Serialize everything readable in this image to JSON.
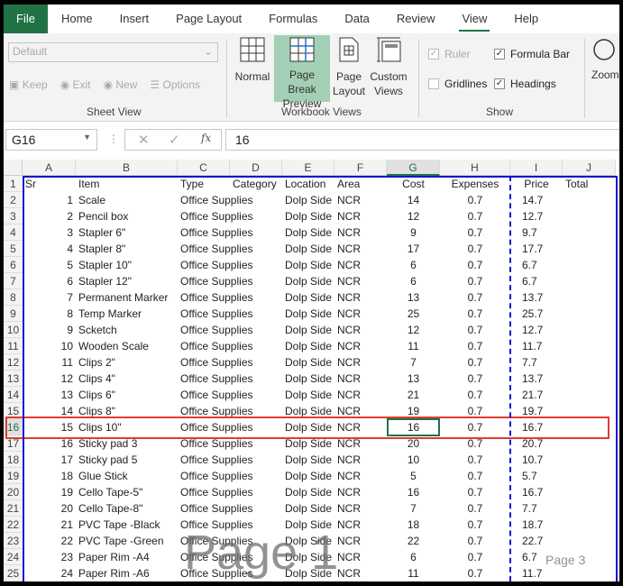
{
  "tabs": [
    "File",
    "Home",
    "Insert",
    "Page Layout",
    "Formulas",
    "Data",
    "Review",
    "View",
    "Help"
  ],
  "active_tab": "View",
  "ribbon": {
    "sheet_view": {
      "dropdown": "Default",
      "keep": "Keep",
      "exit": "Exit",
      "new": "New",
      "options": "Options",
      "label": "Sheet View"
    },
    "workbook_views": {
      "normal": "Normal",
      "page_break_1": "Page Break",
      "page_break_2": "Preview",
      "page_layout_1": "Page",
      "page_layout_2": "Layout",
      "custom_1": "Custom",
      "custom_2": "Views",
      "label": "Workbook Views"
    },
    "show": {
      "ruler": "Ruler",
      "formula_bar": "Formula Bar",
      "gridlines": "Gridlines",
      "headings": "Headings",
      "label": "Show",
      "ruler_checked": true,
      "formula_bar_checked": true,
      "gridlines_checked": false,
      "headings_checked": true
    },
    "zoom": "Zoom"
  },
  "formula_bar": {
    "name_box": "G16",
    "fx": "fx",
    "value": "16"
  },
  "columns": [
    "A",
    "B",
    "C",
    "D",
    "E",
    "F",
    "G",
    "H",
    "I",
    "J"
  ],
  "headers": [
    "Sr",
    "Item",
    "Type",
    "Category",
    "Location",
    "Area",
    "Cost",
    "Expenses",
    "Price",
    "Total"
  ],
  "rows": [
    [
      "1",
      "Scale",
      "Office Supplies",
      "Dolp Side",
      "NCR",
      "14",
      "0.7",
      "14.7"
    ],
    [
      "2",
      "Pencil box",
      "Office Supplies",
      "Dolp Side",
      "NCR",
      "12",
      "0.7",
      "12.7"
    ],
    [
      "3",
      "Stapler 6\"",
      "Office Supplies",
      "Dolp Side",
      "NCR",
      "9",
      "0.7",
      "9.7"
    ],
    [
      "4",
      "Stapler 8\"",
      "Office Supplies",
      "Dolp Side",
      "NCR",
      "17",
      "0.7",
      "17.7"
    ],
    [
      "5",
      "Stapler 10\"",
      "Office Supplies",
      "Dolp Side",
      "NCR",
      "6",
      "0.7",
      "6.7"
    ],
    [
      "6",
      "Stapler 12\"",
      "Office Supplies",
      "Dolp Side",
      "NCR",
      "6",
      "0.7",
      "6.7"
    ],
    [
      "7",
      "Permanent Marker",
      "Office Supplies",
      "Dolp Side",
      "NCR",
      "13",
      "0.7",
      "13.7"
    ],
    [
      "8",
      "Temp Marker",
      "Office Supplies",
      "Dolp Side",
      "NCR",
      "25",
      "0.7",
      "25.7"
    ],
    [
      "9",
      "Scketch",
      "Office Supplies",
      "Dolp Side",
      "NCR",
      "12",
      "0.7",
      "12.7"
    ],
    [
      "10",
      "Wooden Scale",
      "Office Supplies",
      "Dolp Side",
      "NCR",
      "11",
      "0.7",
      "11.7"
    ],
    [
      "11",
      "Clips 2\"",
      "Office Supplies",
      "Dolp Side",
      "NCR",
      "7",
      "0.7",
      "7.7"
    ],
    [
      "12",
      "Clips 4\"",
      "Office Supplies",
      "Dolp Side",
      "NCR",
      "13",
      "0.7",
      "13.7"
    ],
    [
      "13",
      "Clips 6\"",
      "Office Supplies",
      "Dolp Side",
      "NCR",
      "21",
      "0.7",
      "21.7"
    ],
    [
      "14",
      "Clips 8\"",
      "Office Supplies",
      "Dolp Side",
      "NCR",
      "19",
      "0.7",
      "19.7"
    ],
    [
      "15",
      "Clips 10\"",
      "Office Supplies",
      "Dolp Side",
      "NCR",
      "16",
      "0.7",
      "16.7"
    ],
    [
      "16",
      "Sticky pad  3",
      "Office Supplies",
      "Dolp Side",
      "NCR",
      "20",
      "0.7",
      "20.7"
    ],
    [
      "17",
      "Sticky pad  5",
      "Office Supplies",
      "Dolp Side",
      "NCR",
      "10",
      "0.7",
      "10.7"
    ],
    [
      "18",
      "Glue Stick",
      "Office Supplies",
      "Dolp Side",
      "NCR",
      "5",
      "0.7",
      "5.7"
    ],
    [
      "19",
      "Cello Tape-5\"",
      "Office Supplies",
      "Dolp Side",
      "NCR",
      "16",
      "0.7",
      "16.7"
    ],
    [
      "20",
      "Cello Tape-8\"",
      "Office Supplies",
      "Dolp Side",
      "NCR",
      "7",
      "0.7",
      "7.7"
    ],
    [
      "21",
      "PVC Tape -Black",
      "Office Supplies",
      "Dolp Side",
      "NCR",
      "18",
      "0.7",
      "18.7"
    ],
    [
      "22",
      "PVC Tape -Green",
      "Office Supplies",
      "Dolp Side",
      "NCR",
      "22",
      "0.7",
      "22.7"
    ],
    [
      "23",
      "Paper Rim -A4",
      "Office Supplies",
      "Dolp Side",
      "NCR",
      "6",
      "0.7",
      "6.7"
    ],
    [
      "24",
      "Paper Rim -A6",
      "Office Supplies",
      "Dolp Side",
      "NCR",
      "11",
      "0.7",
      "11.7"
    ]
  ],
  "selected_row": 16,
  "watermarks": {
    "page1": "Page 1",
    "page3": "Page 3"
  },
  "colors": {
    "accent": "#217346",
    "page_break": "#1414d0",
    "highlight": "#e03c31"
  }
}
